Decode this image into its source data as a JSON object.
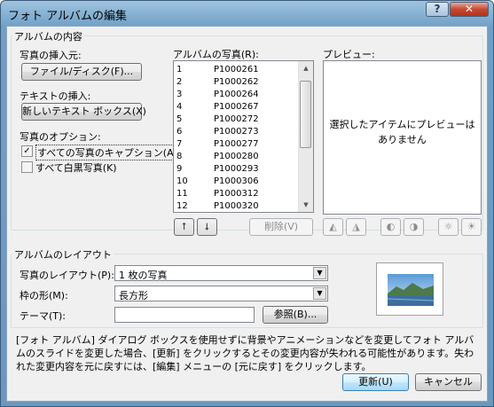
{
  "window": {
    "title": "フォト アルバムの編集",
    "help": "?",
    "close": "✕"
  },
  "album_content": {
    "label": "アルバムの内容",
    "insert_photo_label": "写真の挿入元:",
    "file_disk_button": "ファイル/ディスク(F)...",
    "insert_text_label": "テキストの挿入:",
    "new_textbox_button": "新しいテキスト ボックス(X)",
    "photo_options_label": "写真のオプション:",
    "caption_checkbox_label": "すべての写真のキャプション(A)",
    "caption_checked": true,
    "bw_checkbox_label": "すべて白黒写真(K)",
    "bw_checked": false
  },
  "photos": {
    "label": "アルバムの写真(R):",
    "items": [
      {
        "num": "1",
        "name": "P1000261"
      },
      {
        "num": "2",
        "name": "P1000262"
      },
      {
        "num": "3",
        "name": "P1000264"
      },
      {
        "num": "4",
        "name": "P1000267"
      },
      {
        "num": "5",
        "name": "P1000272"
      },
      {
        "num": "6",
        "name": "P1000273"
      },
      {
        "num": "7",
        "name": "P1000277"
      },
      {
        "num": "8",
        "name": "P1000280"
      },
      {
        "num": "9",
        "name": "P1000293"
      },
      {
        "num": "10",
        "name": "P1000306"
      },
      {
        "num": "11",
        "name": "P1000312"
      },
      {
        "num": "12",
        "name": "P1000320"
      }
    ],
    "delete_button": "削除(V)"
  },
  "preview": {
    "label": "プレビュー:",
    "message": "選択したアイテムにプレビューはありません"
  },
  "layout": {
    "label": "アルバムのレイアウト",
    "picture_layout_label": "写真のレイアウト(P):",
    "picture_layout_value": "1 枚の写真",
    "frame_shape_label": "枠の形(M):",
    "frame_shape_value": "長方形",
    "theme_label": "テーマ(T):",
    "theme_value": "",
    "browse_button": "参照(B)..."
  },
  "note": "[フォト アルバム] ダイアログ ボックスを使用せずに背景やアニメーションなどを変更してフォト アルバムのスライドを変更した場合、[更新] をクリックするとその変更内容が失われる可能性があります。失われた変更内容を元に戻すには、[編集] メニューの [元に戻す] をクリックします。",
  "buttons": {
    "update": "更新(U)",
    "cancel": "キャンセル"
  }
}
